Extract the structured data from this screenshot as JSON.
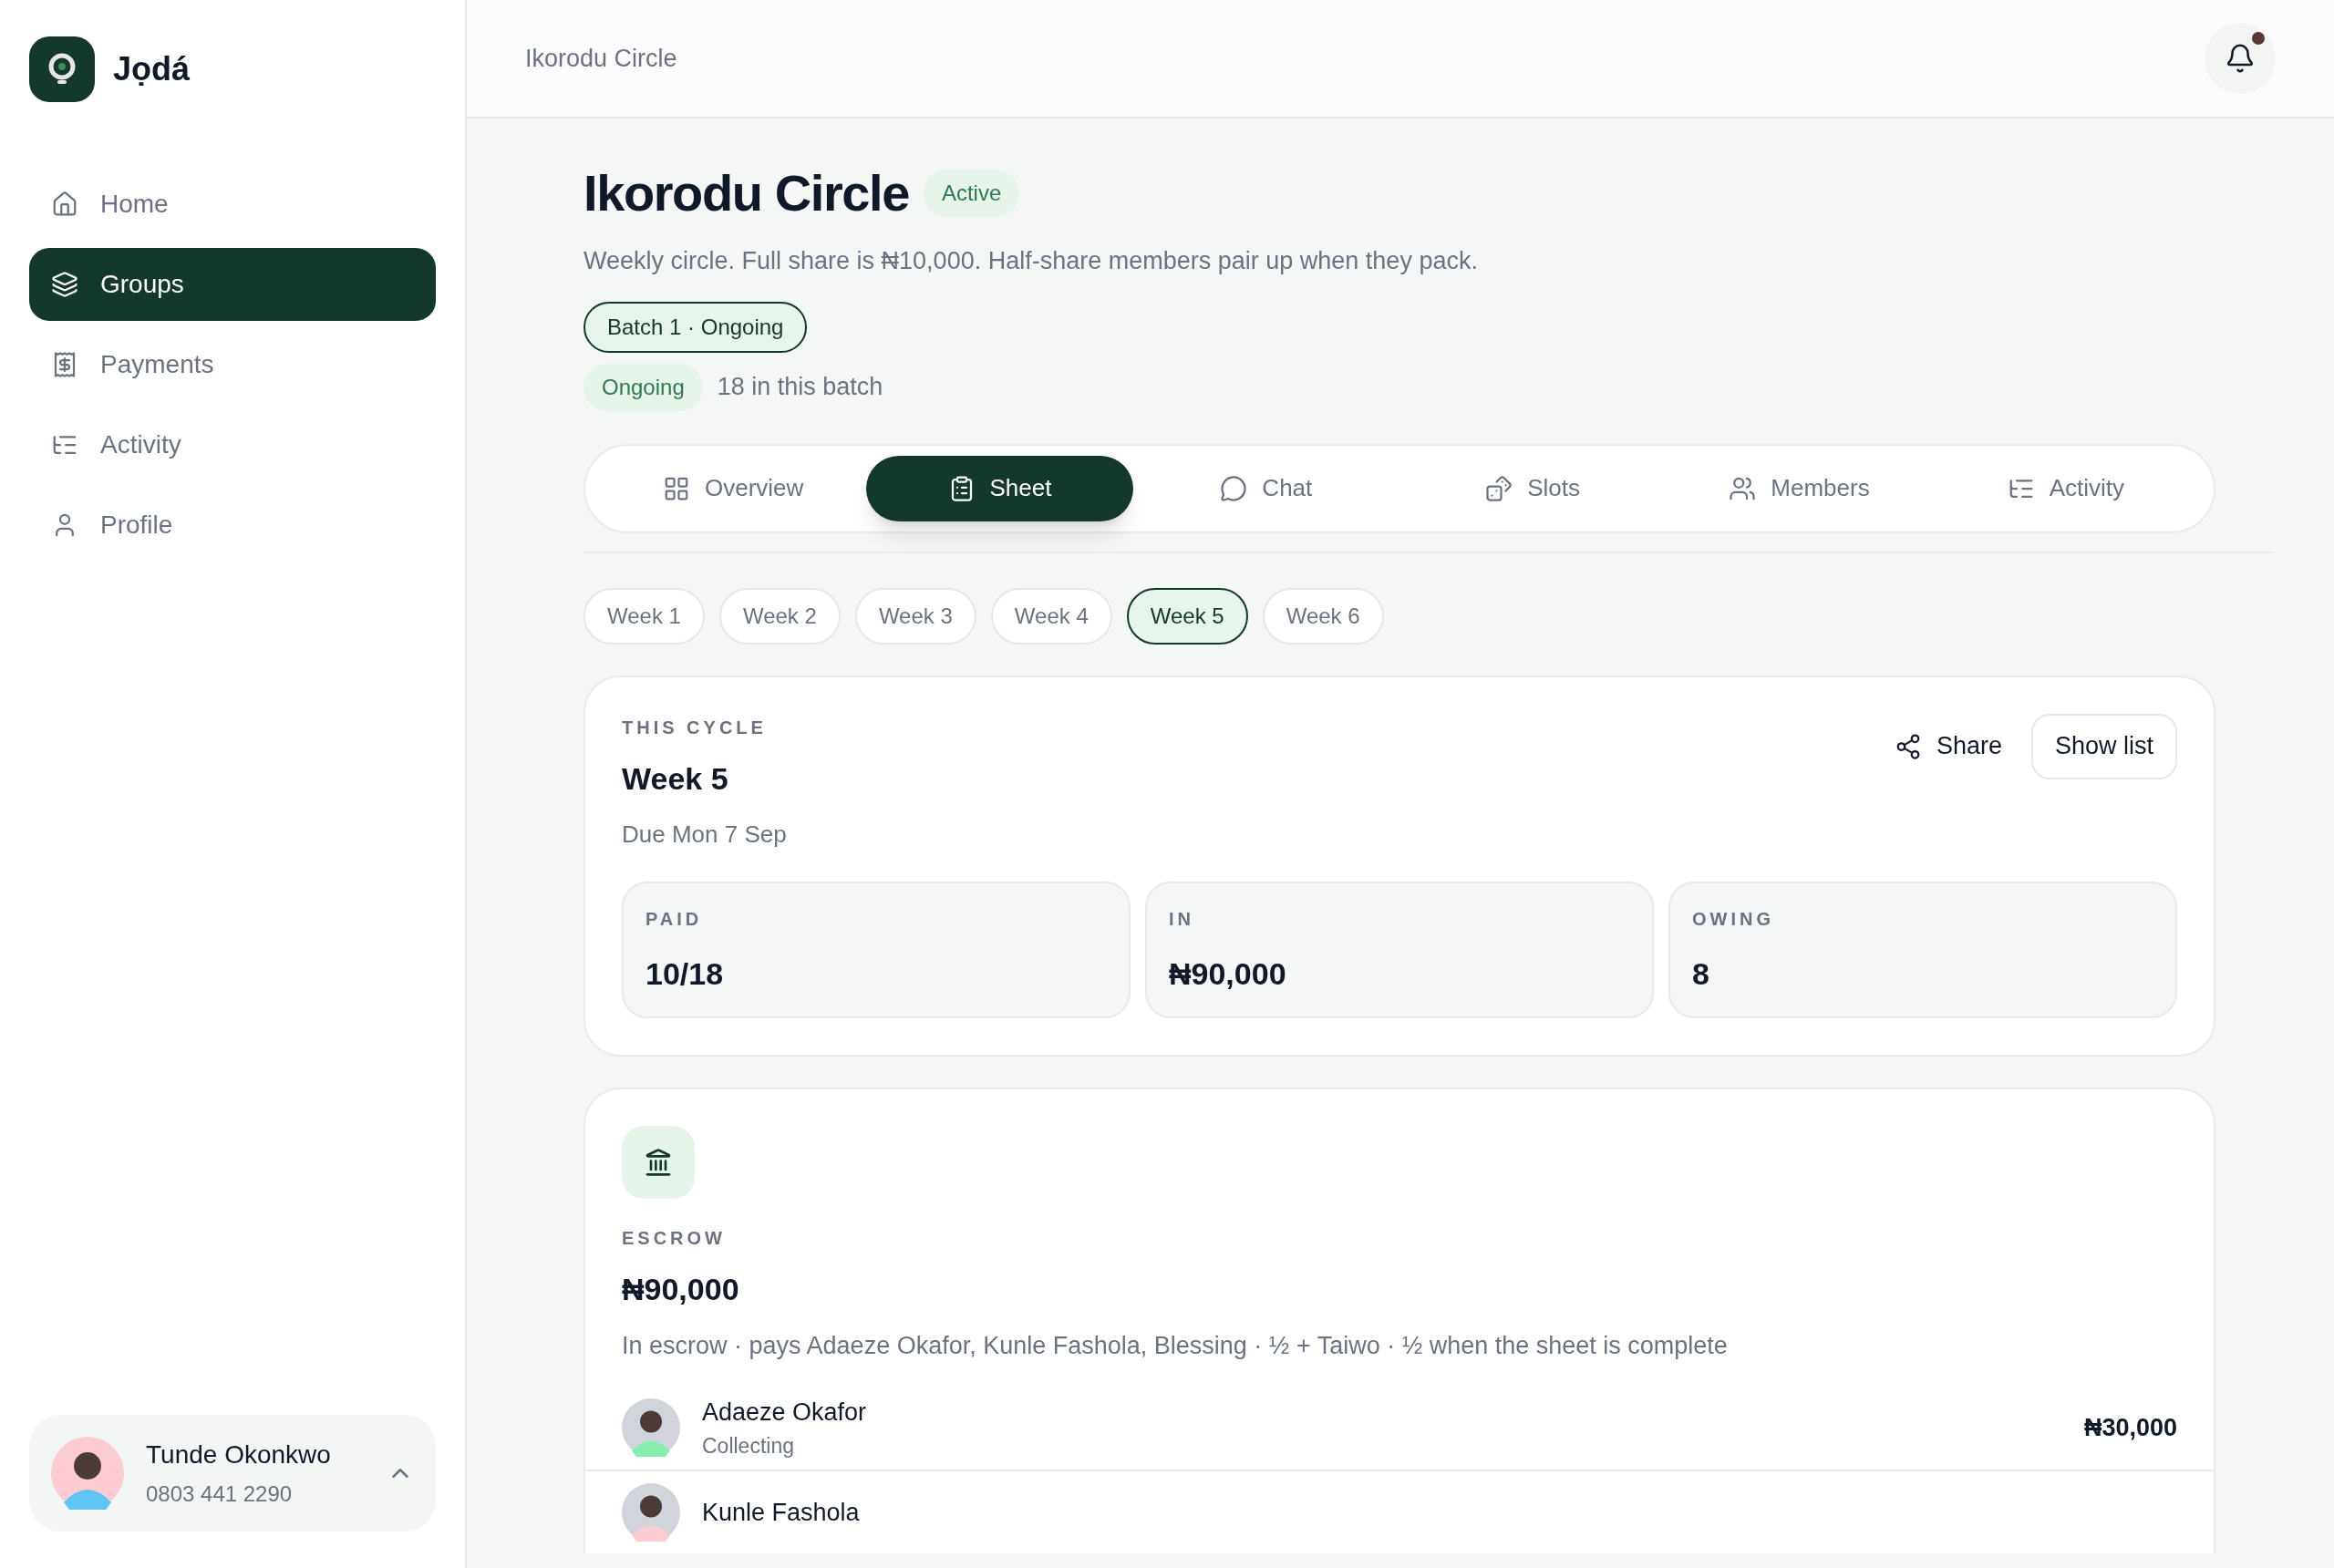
{
  "app": {
    "name": "Jọdá"
  },
  "sidebar": {
    "items": [
      {
        "label": "Home",
        "selected": false
      },
      {
        "label": "Groups",
        "selected": true
      },
      {
        "label": "Payments",
        "selected": false
      },
      {
        "label": "Activity",
        "selected": false
      },
      {
        "label": "Profile",
        "selected": false
      }
    ]
  },
  "user": {
    "name": "Tunde Okonkwo",
    "phone": "0803 441 2290"
  },
  "header": {
    "title": "Ikorodu Circle"
  },
  "group": {
    "title": "Ikorodu Circle",
    "status": "Active",
    "description": "Weekly circle. Full share is ₦10,000. Half-share members pair up when they pack.",
    "batch": "Batch 1 · Ongoing",
    "batch_status": "Ongoing",
    "batch_count": "18 in this batch"
  },
  "tabs": [
    {
      "label": "Overview",
      "selected": false
    },
    {
      "label": "Sheet",
      "selected": true
    },
    {
      "label": "Chat",
      "selected": false
    },
    {
      "label": "Slots",
      "selected": false
    },
    {
      "label": "Members",
      "selected": false
    },
    {
      "label": "Activity",
      "selected": false
    }
  ],
  "weeks": [
    {
      "label": "Week 1",
      "selected": false
    },
    {
      "label": "Week 2",
      "selected": false
    },
    {
      "label": "Week 3",
      "selected": false
    },
    {
      "label": "Week 4",
      "selected": false
    },
    {
      "label": "Week 5",
      "selected": true
    },
    {
      "label": "Week 6",
      "selected": false
    }
  ],
  "cycle": {
    "eyebrow": "THIS CYCLE",
    "title": "Week 5",
    "due": "Due Mon 7 Sep",
    "share": "Share",
    "show_list": "Show list",
    "stats": [
      {
        "label": "PAID",
        "value": "10/18"
      },
      {
        "label": "IN",
        "value": "₦90,000"
      },
      {
        "label": "OWING",
        "value": "8"
      }
    ]
  },
  "escrow": {
    "eyebrow": "ESCROW",
    "amount": "₦90,000",
    "description": "In escrow · pays Adaeze Okafor, Kunle Fashola, Blessing · ½ + Taiwo · ½ when the sheet is complete",
    "payees": [
      {
        "name": "Adaeze Okafor",
        "status": "Collecting",
        "amount": "₦30,000"
      },
      {
        "name": "Kunle Fashola"
      }
    ]
  }
}
